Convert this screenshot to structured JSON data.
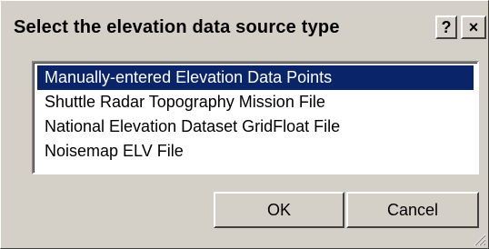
{
  "dialog": {
    "title": "Select the elevation data source type",
    "help_label": "?",
    "close_label": "×"
  },
  "list": {
    "items": [
      {
        "label": "Manually-entered Elevation Data Points",
        "selected": true
      },
      {
        "label": "Shuttle Radar Topography Mission File",
        "selected": false
      },
      {
        "label": "National Elevation Dataset GridFloat File",
        "selected": false
      },
      {
        "label": "Noisemap ELV File",
        "selected": false
      }
    ]
  },
  "buttons": {
    "ok_label": "OK",
    "cancel_label": "Cancel"
  },
  "colors": {
    "face": "#d4d0c8",
    "selection": "#0a246a"
  },
  "icons": {
    "help": "question-mark-icon",
    "close": "close-icon",
    "grip": "resize-grip-icon"
  }
}
